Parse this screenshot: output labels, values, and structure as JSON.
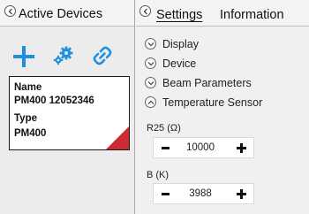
{
  "devices_panel": {
    "title": "Active Devices",
    "collapse_icon": "chevron-left-icon",
    "toolbar": {
      "add_icon": "plus-icon",
      "settings_icon": "gears-icon",
      "link_icon": "link-icon",
      "accent_color": "#1e90e0"
    },
    "device_card": {
      "name_label": "Name",
      "name_value": "PM400 12052346",
      "type_label": "Type",
      "type_value": "PM400",
      "corner_color": "#cc2a34"
    }
  },
  "settings_panel": {
    "collapse_icon": "chevron-left-icon",
    "tabs": [
      {
        "label": "Settings",
        "active": true
      },
      {
        "label": "Information",
        "active": false
      }
    ],
    "sections": [
      {
        "label": "Display",
        "icon": "chevron-down-icon",
        "expanded": false
      },
      {
        "label": "Device",
        "icon": "chevron-down-icon",
        "expanded": false
      },
      {
        "label": "Beam Parameters",
        "icon": "chevron-down-icon",
        "expanded": false
      },
      {
        "label": "Temperature Sensor",
        "icon": "chevron-up-icon",
        "expanded": true
      }
    ],
    "temperature_sensor": {
      "r25": {
        "label": "R25 (Ω)",
        "value": "10000"
      },
      "b": {
        "label": "B (K)",
        "value": "3988"
      }
    }
  }
}
